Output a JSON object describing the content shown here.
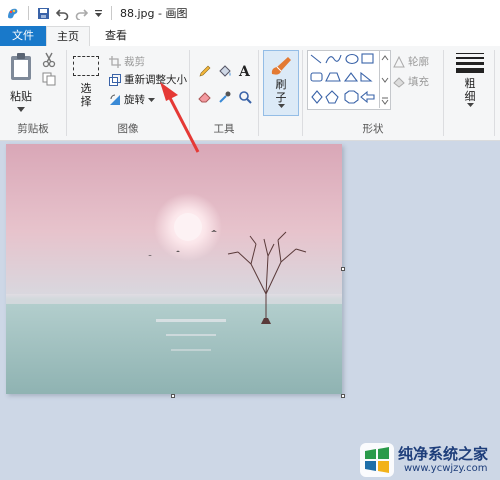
{
  "titlebar": {
    "title": "88.jpg - 画图",
    "icons": [
      "paint-app-icon",
      "save-icon",
      "undo-icon",
      "redo-icon",
      "customize-dropdown-icon"
    ]
  },
  "tabs": [
    {
      "label": "文件"
    },
    {
      "label": "主页"
    },
    {
      "label": "查看"
    }
  ],
  "ribbon": {
    "clipboard": {
      "paste": "粘贴",
      "group": "剪贴板"
    },
    "image": {
      "select": "选\n择",
      "crop": "裁剪",
      "resize": "重新调整大小",
      "rotate": "旋转",
      "group": "图像"
    },
    "tools": {
      "group": "工具"
    },
    "brushes": {
      "label": "刷\n子"
    },
    "shapes": {
      "outline": "轮廓",
      "fill": "填充",
      "group": "形状"
    },
    "size": {
      "label": "粗\n细"
    }
  },
  "watermark": {
    "title": "纯净系统之家",
    "url": "www.ycwjzy.com"
  },
  "colors": {
    "accent": "#1979ca",
    "canvas_bg": "#cdd7e6",
    "ribbon_bg": "#f5f6f7",
    "annotation_arrow": "#e53935"
  }
}
